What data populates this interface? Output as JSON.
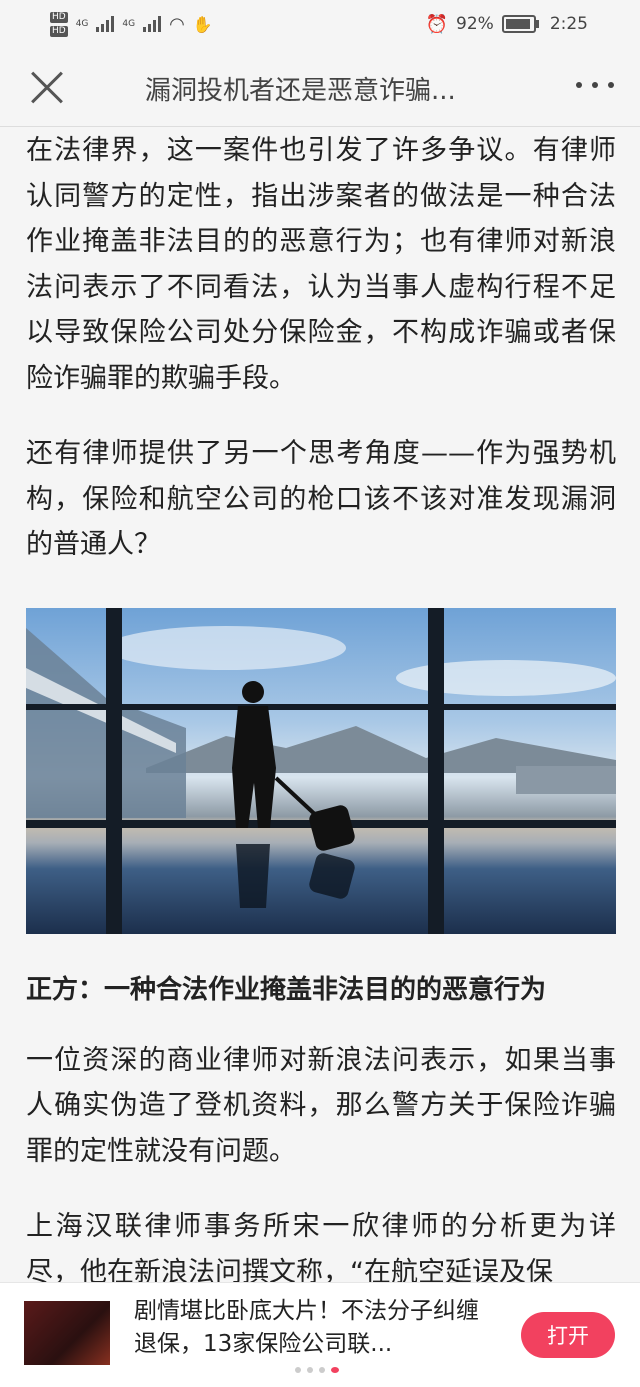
{
  "status_bar": {
    "hd1": "HD",
    "hd2": "HD",
    "network1": "4G",
    "network2": "4G",
    "battery_percent": "92%",
    "time": "2:25"
  },
  "header": {
    "title": "漏洞投机者还是恶意诈骗..."
  },
  "article": {
    "paragraphs_top": [
      "在法律界，这一案件也引发了许多争议。有律师认同警方的定性，指出涉案者的做法是一种合法作业掩盖非法目的的恶意行为；也有律师对新浪法问表示了不同看法，认为当事人虚构行程不足以导致保险公司处分保险金，不构成诈骗或者保险诈骗罪的欺骗手段。",
      "还有律师提供了另一个思考角度——作为强势机构，保险和航空公司的枪口该不该对准发现漏洞的普通人？"
    ],
    "heading": "正方：一种合法作业掩盖非法目的的恶意行为",
    "paragraphs_bottom": [
      "一位资深的商业律师对新浪法问表示，如果当事人确实伪造了登机资料，那么警方关于保险诈骗罪的定性就没有问题。",
      "上海汉联律师事务所宋一欣律师的分析更为详尽，他在新浪法问撰文称，“在航空延误及保"
    ]
  },
  "ad": {
    "text": "剧情堪比卧底大片！不法分子纠缠退保，13家保险公司联...",
    "button": "打开"
  },
  "colors": {
    "accent": "#f2415f",
    "background": "#f5f5f5"
  }
}
